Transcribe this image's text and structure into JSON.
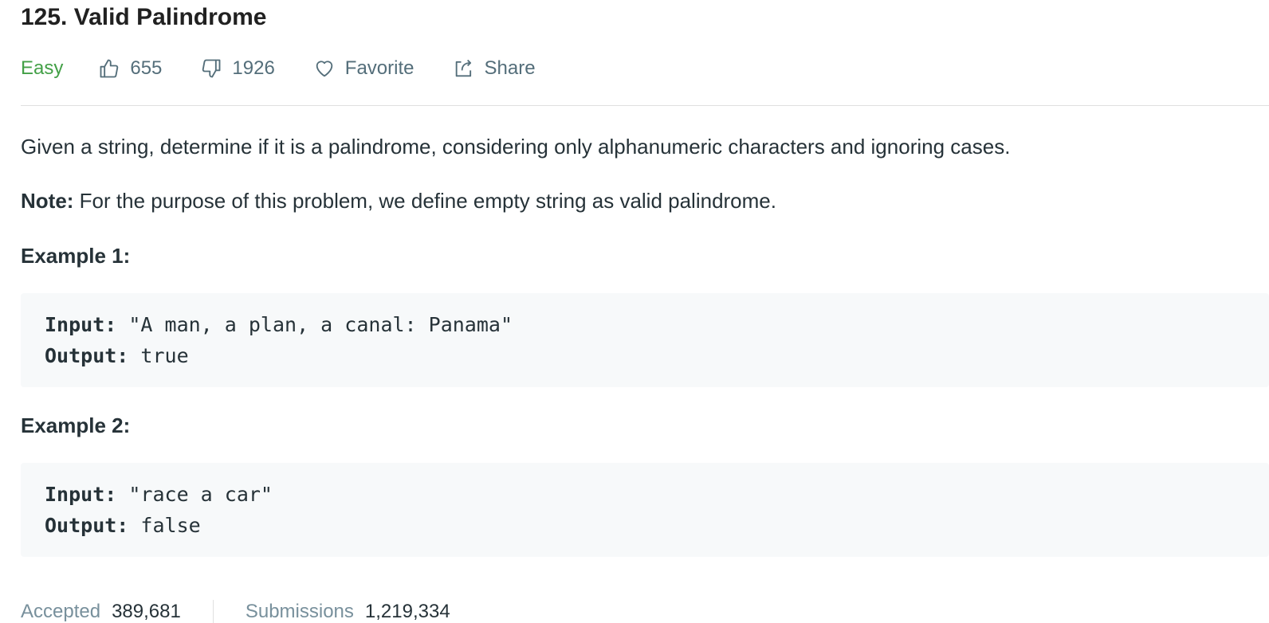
{
  "problem": {
    "title": "125. Valid Palindrome",
    "difficulty": "Easy",
    "likes": "655",
    "dislikes": "1926",
    "favorite_label": "Favorite",
    "share_label": "Share"
  },
  "description": {
    "main": "Given a string, determine if it is a palindrome, considering only alphanumeric characters and ignoring cases.",
    "note_label": "Note:",
    "note_text": " For the purpose of this problem, we define empty string as valid palindrome."
  },
  "examples": [
    {
      "heading": "Example 1:",
      "input_label": "Input:",
      "input_value": " \"A man, a plan, a canal: Panama\"",
      "output_label": "Output:",
      "output_value": " true"
    },
    {
      "heading": "Example 2:",
      "input_label": "Input:",
      "input_value": " \"race a car\"",
      "output_label": "Output:",
      "output_value": " false"
    }
  ],
  "stats": {
    "accepted_label": "Accepted",
    "accepted_value": "389,681",
    "submissions_label": "Submissions",
    "submissions_value": "1,219,334"
  },
  "icons": {
    "like": "thumbs-up-icon",
    "dislike": "thumbs-down-icon",
    "favorite": "heart-icon",
    "share": "share-icon"
  },
  "colors": {
    "easy": "#43a047",
    "muted": "#546e7a",
    "code_bg": "#f7f9fa"
  }
}
